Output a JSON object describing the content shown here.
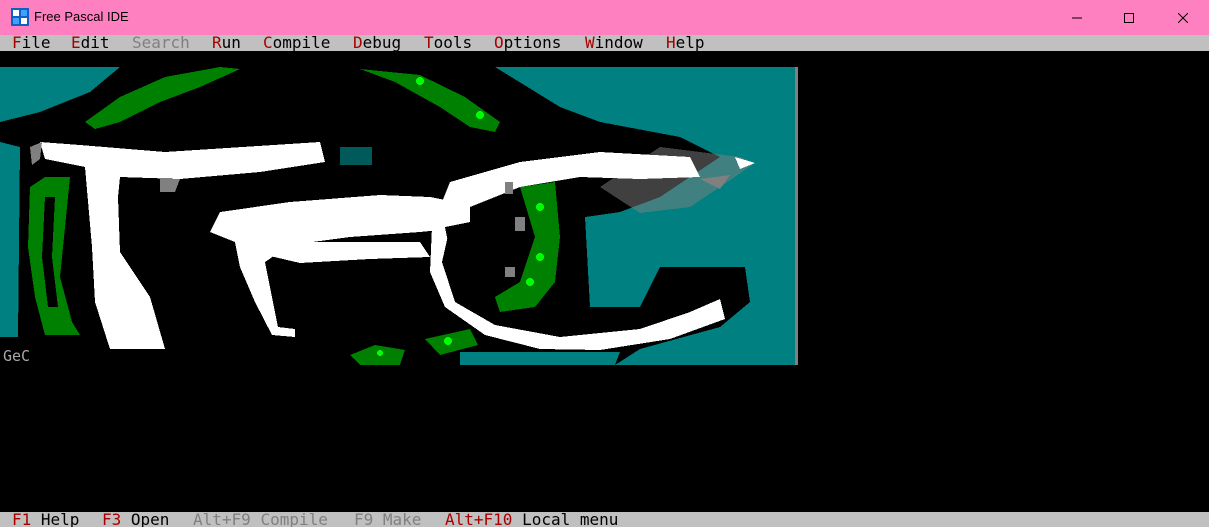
{
  "window": {
    "title": "Free Pascal IDE",
    "icon": "fpc-app-icon",
    "controls": [
      "minimize-icon",
      "maximize-icon",
      "close-icon"
    ]
  },
  "menubar": {
    "items": [
      {
        "hotkey": "F",
        "rest": "ile",
        "enabled": true
      },
      {
        "hotkey": "E",
        "rest": "dit",
        "enabled": true
      },
      {
        "hotkey": "S",
        "rest": "earch",
        "enabled": false
      },
      {
        "hotkey": "R",
        "rest": "un",
        "enabled": true
      },
      {
        "hotkey": "C",
        "rest": "ompile",
        "enabled": true
      },
      {
        "hotkey": "D",
        "rest": "ebug",
        "enabled": true
      },
      {
        "hotkey": "T",
        "rest": "ools",
        "enabled": true
      },
      {
        "hotkey": "O",
        "rest": "ptions",
        "enabled": true
      },
      {
        "hotkey": "W",
        "rest": "indow",
        "enabled": true
      },
      {
        "hotkey": "H",
        "rest": "elp",
        "enabled": true
      }
    ]
  },
  "desktop": {
    "logo_caption": "GeC"
  },
  "statusbar": {
    "items": [
      {
        "key": "F1",
        "label": "Help",
        "enabled": true
      },
      {
        "key": "F3",
        "label": "Open",
        "enabled": true
      },
      {
        "key": "Alt+F9",
        "label": "Compile",
        "enabled": false
      },
      {
        "key": "F9",
        "label": "Make",
        "enabled": false
      },
      {
        "key": "Alt+F10",
        "label": "Local menu",
        "enabled": true
      }
    ]
  },
  "colors": {
    "titlebar": "#ff80c0",
    "menubar": "#c0c0c0",
    "hotkey": "#a80000",
    "disabled": "#808080",
    "desktop": "#000000",
    "logo_teal": "#008080",
    "logo_green": "#008000",
    "logo_bright_green": "#00ff00",
    "logo_white": "#ffffff"
  }
}
